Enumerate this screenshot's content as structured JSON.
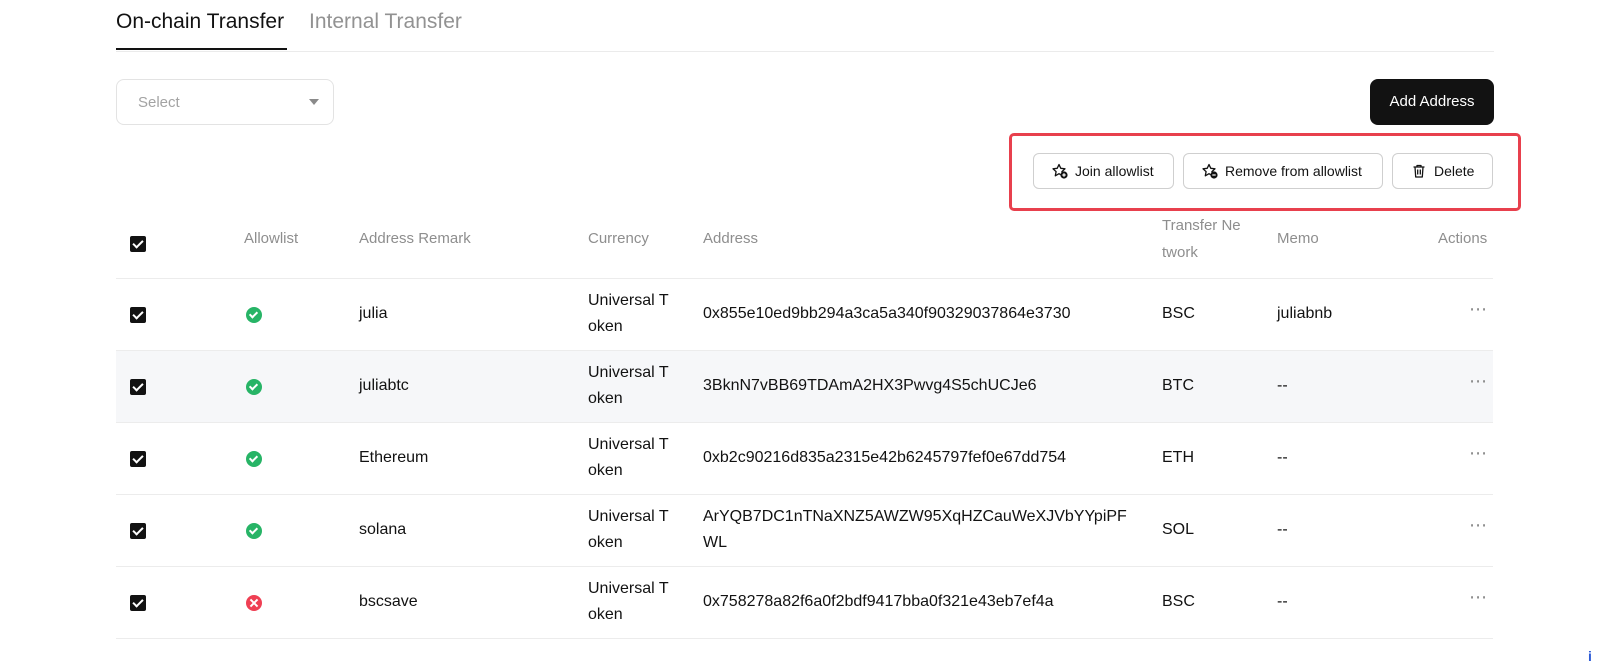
{
  "tabs": [
    {
      "label": "On-chain Transfer",
      "active": true
    },
    {
      "label": "Internal Transfer",
      "active": false
    }
  ],
  "filter": {
    "placeholder": "Select"
  },
  "add_button": "Add Address",
  "bulk_actions": {
    "join": "Join allowlist",
    "remove": "Remove from allowlist",
    "delete": "Delete"
  },
  "table": {
    "headers": {
      "allowlist": "Allowlist",
      "remark": "Address Remark",
      "currency": "Currency",
      "address": "Address",
      "network_line1": "Transfer Ne",
      "network_line2": "twork",
      "memo": "Memo",
      "actions": "Actions"
    },
    "rows": [
      {
        "allowlisted": true,
        "remark": "julia",
        "currency_line1": "Universal T",
        "currency_line2": "oken",
        "address_line1": "0x855e10ed9bb294a3ca5a340f90329037864e3730",
        "address_line2": "",
        "network": "BSC",
        "memo": "juliabnb"
      },
      {
        "allowlisted": true,
        "remark": "juliabtc",
        "currency_line1": "Universal T",
        "currency_line2": "oken",
        "address_line1": "3BknN7vBB69TDAmA2HX3Pwvg4S5chUCJe6",
        "address_line2": "",
        "network": "BTC",
        "memo": "--"
      },
      {
        "allowlisted": true,
        "remark": "Ethereum",
        "currency_line1": "Universal T",
        "currency_line2": "oken",
        "address_line1": "0xb2c90216d835a2315e42b6245797fef0e67dd754",
        "address_line2": "",
        "network": "ETH",
        "memo": "--"
      },
      {
        "allowlisted": true,
        "remark": "solana",
        "currency_line1": "Universal T",
        "currency_line2": "oken",
        "address_line1": "ArYQB7DC1nTNaXNZ5AWZW95XqHZCauWeXJVbYYpiPF",
        "address_line2": "WL",
        "network": "SOL",
        "memo": "--"
      },
      {
        "allowlisted": false,
        "remark": "bscsave",
        "currency_line1": "Universal T",
        "currency_line2": "oken",
        "address_line1": "0x758278a82f6a0f2bdf9417bba0f321e43eb7ef4a",
        "address_line2": "",
        "network": "BSC",
        "memo": "--"
      }
    ]
  },
  "colors": {
    "highlight": "#e8404d",
    "ok": "#27b466",
    "error": "#ef3f53",
    "primary": "#121212"
  },
  "icons": {
    "join": "star-plus-icon",
    "remove": "star-minus-icon",
    "delete": "trash-icon",
    "more": "more-dots-icon"
  }
}
